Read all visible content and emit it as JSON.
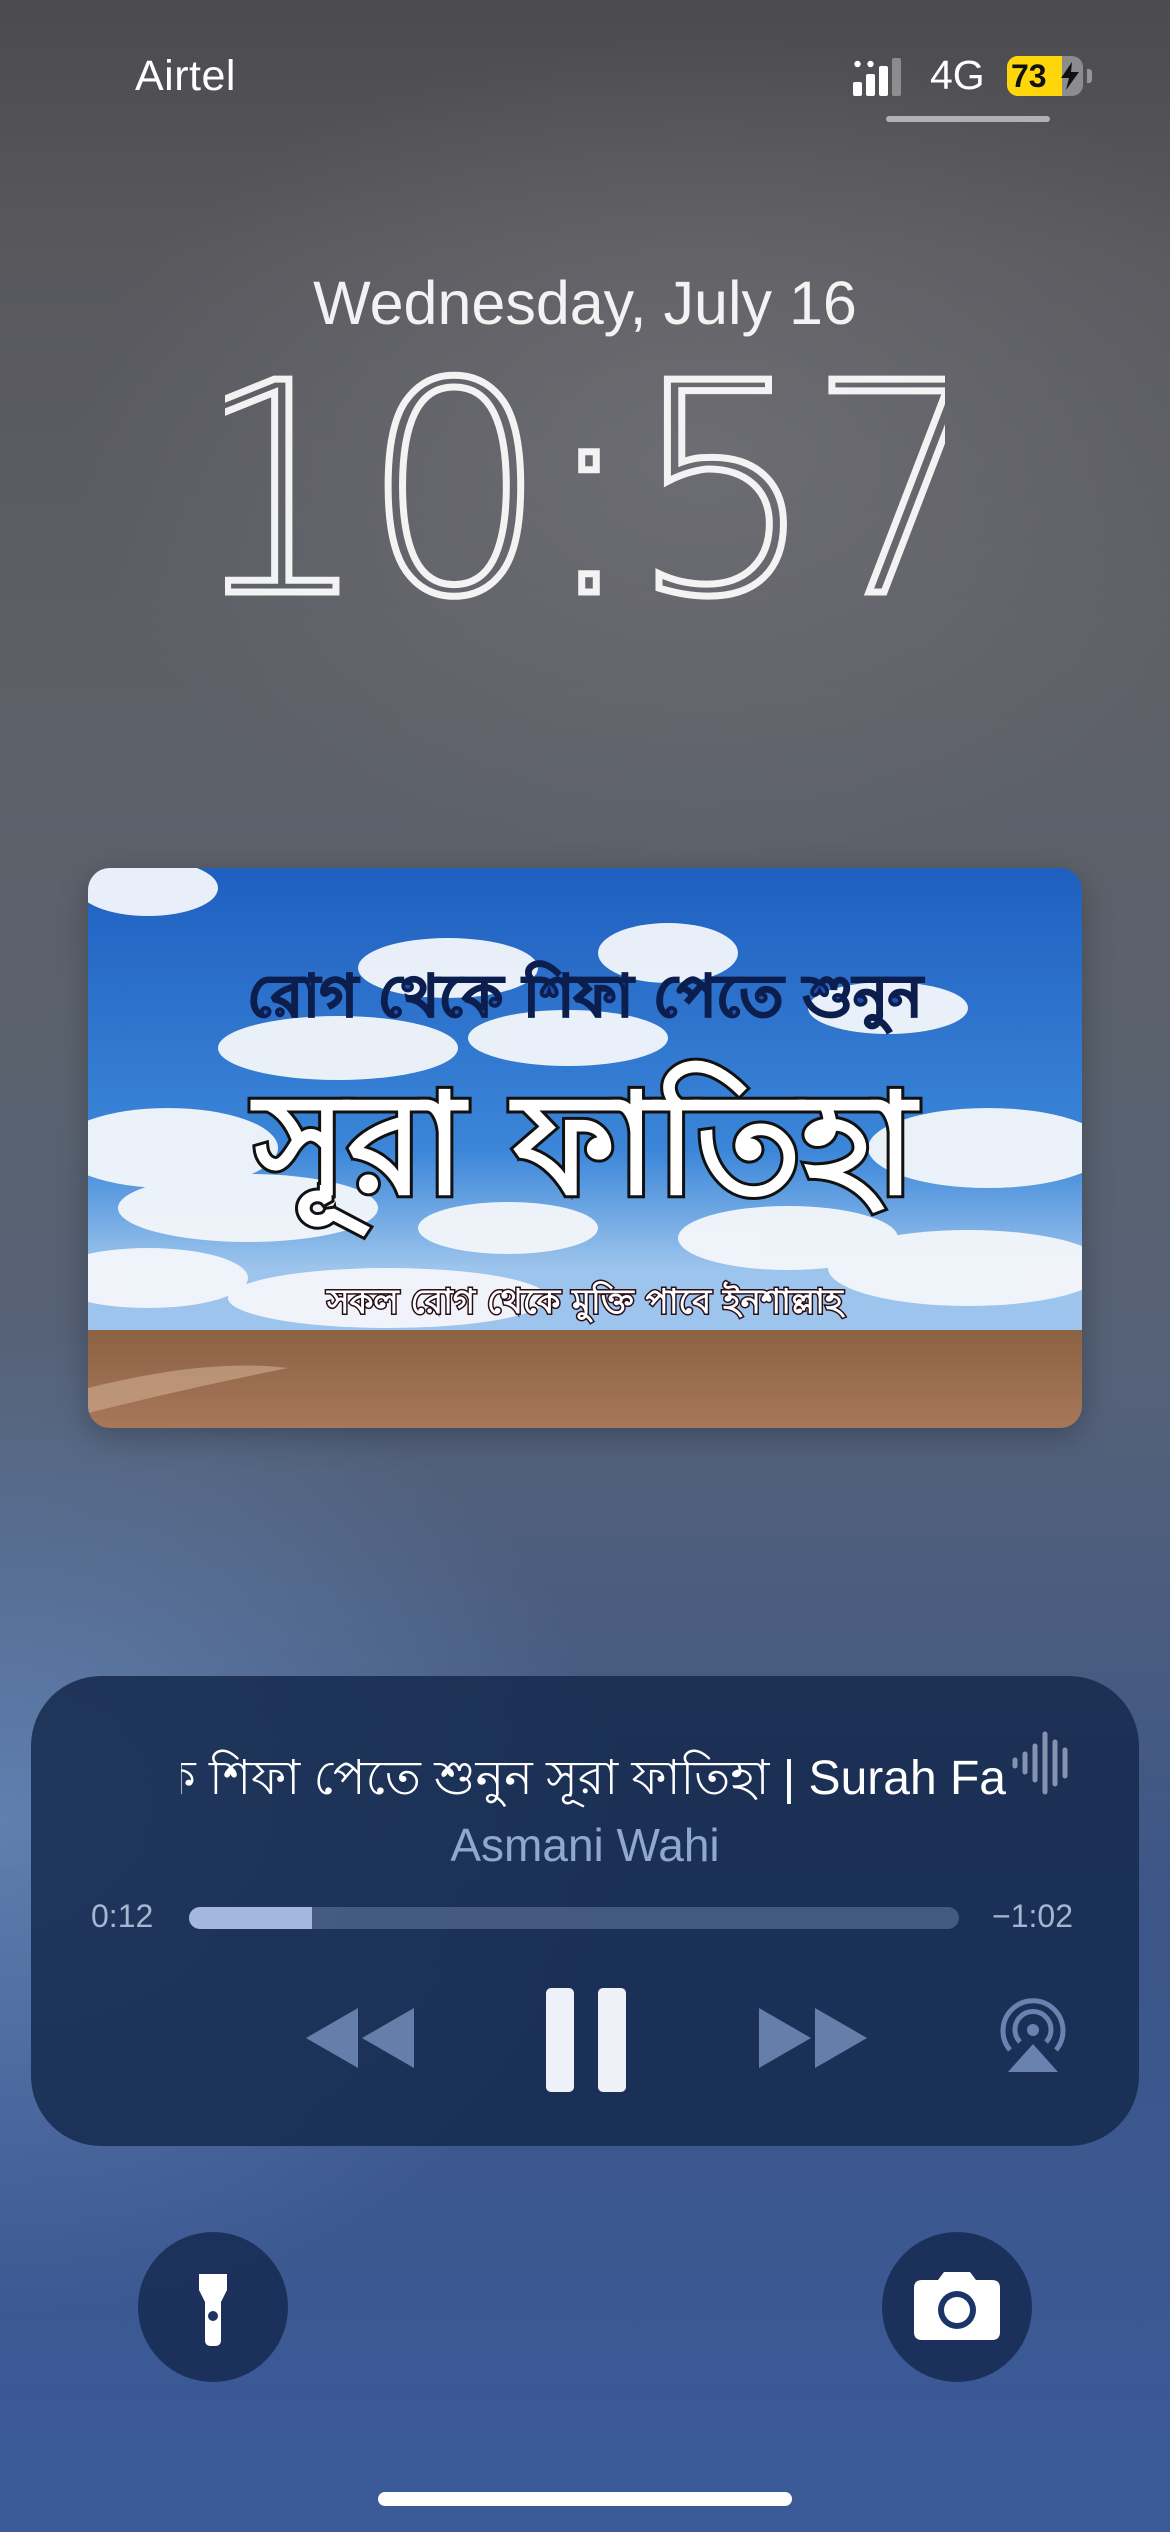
{
  "status_bar": {
    "carrier": "Airtel",
    "network": "4G",
    "battery_percent": "73",
    "charging": true,
    "icons": [
      "signal-bars-icon",
      "battery-icon",
      "charging-bolt-icon"
    ]
  },
  "lock_screen": {
    "date": "Wednesday, July 16",
    "time": "10:57"
  },
  "artwork": {
    "headline": "রোগ থেকে শিফা পেতে শুনুন",
    "title": "সূরা ফাতিহা",
    "subtitle": "সকল রোগ থেকে মুক্তি পাবে ইনশাল্লাহ"
  },
  "now_playing": {
    "title": "রোগ থেকে শিফা পেতে শুনুন সূরা ফাতিহা | Surah Fa",
    "artist": "Asmani Wahi",
    "elapsed": "0:12",
    "remaining": "−1:02",
    "progress": 0.16,
    "icons": [
      "waveform-icon",
      "rewind-icon",
      "pause-icon",
      "fast-forward-icon",
      "airplay-icon"
    ]
  },
  "quick_actions": {
    "left_icon": "flashlight-icon",
    "right_icon": "camera-icon"
  },
  "colors": {
    "battery_fill": "#ffd60a",
    "player_background": "#162a4e",
    "progress_fill": "#aabee1"
  }
}
